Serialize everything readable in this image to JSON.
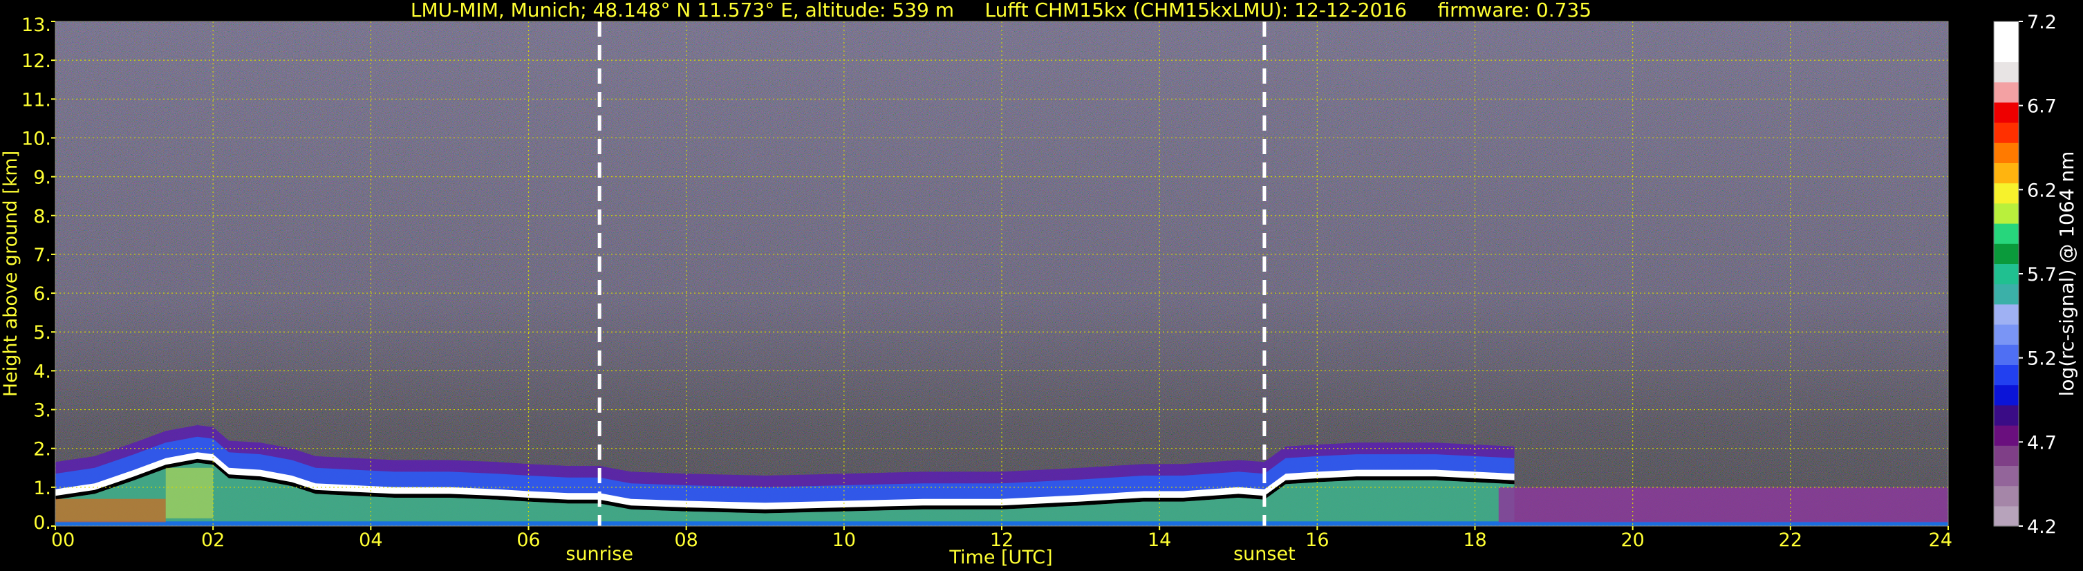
{
  "chart_data": {
    "type": "heatmap",
    "title": "LMU-MIM, Munich; 48.148° N 11.573° E, altitude: 539 m     Lufft CHM15kx (CHM15kxLMU): 12-12-2016     firmware: 0.735",
    "xlabel": "Time [UTC]",
    "ylabel": "Height above ground [km]",
    "xlim": [
      0,
      24
    ],
    "ylim": [
      0,
      13
    ],
    "x_ticks": [
      "00",
      "02",
      "04",
      "06",
      "08",
      "10",
      "12",
      "14",
      "16",
      "18",
      "20",
      "22",
      "24"
    ],
    "x_tick_values": [
      0,
      2,
      4,
      6,
      8,
      10,
      12,
      14,
      16,
      18,
      20,
      22,
      24
    ],
    "y_ticks": [
      "0.",
      "1.",
      "2.",
      "3.",
      "4.",
      "5.",
      "6.",
      "7.",
      "8.",
      "9.",
      "10.",
      "11.",
      "12.",
      "13."
    ],
    "y_tick_values": [
      0,
      1,
      2,
      3,
      4,
      5,
      6,
      7,
      8,
      9,
      10,
      11,
      12,
      13
    ],
    "grid": true,
    "markers": [
      {
        "label": "sunrise",
        "x": 6.9
      },
      {
        "label": "sunset",
        "x": 15.33
      }
    ],
    "boundary_layer_top": {
      "x": [
        0,
        0.5,
        1.0,
        1.4,
        1.8,
        2.0,
        2.2,
        2.6,
        3.0,
        3.3,
        3.8,
        4.3,
        5.0,
        5.6,
        6.0,
        6.5,
        6.9,
        7.3,
        8.0,
        9.0,
        10.0,
        11.0,
        12.0,
        13.0,
        13.8,
        14.3,
        15.0,
        15.33,
        15.6,
        16.0,
        16.5,
        17.0,
        17.5,
        18.0,
        18.5
      ],
      "y": [
        0.8,
        0.95,
        1.3,
        1.6,
        1.75,
        1.7,
        1.35,
        1.3,
        1.15,
        0.95,
        0.9,
        0.85,
        0.85,
        0.8,
        0.75,
        0.7,
        0.7,
        0.55,
        0.5,
        0.45,
        0.5,
        0.55,
        0.55,
        0.65,
        0.75,
        0.75,
        0.85,
        0.8,
        1.2,
        1.25,
        1.3,
        1.3,
        1.3,
        1.25,
        1.2
      ]
    },
    "colorbar": {
      "label": "log(rc-signal) @ 1064 nm",
      "ticks": [
        "4.2",
        "4.7",
        "5.2",
        "5.7",
        "6.2",
        "6.7",
        "7.2"
      ],
      "range": [
        4.2,
        7.2
      ],
      "colors": [
        "#b7a3bb",
        "#a586a8",
        "#93659a",
        "#7f3f87",
        "#6a0f7e",
        "#3a0c86",
        "#0b14d8",
        "#2240f0",
        "#4f6ff3",
        "#7a95f5",
        "#9fb1f3",
        "#3bb0a8",
        "#20c090",
        "#0a9a3b",
        "#27d67c",
        "#b9f03c",
        "#f7f22c",
        "#ffb40f",
        "#ff7a00",
        "#ff3000",
        "#ee0000",
        "#f3a1a3",
        "#e8e4e4",
        "#ffffff",
        "#ffffff"
      ]
    }
  }
}
